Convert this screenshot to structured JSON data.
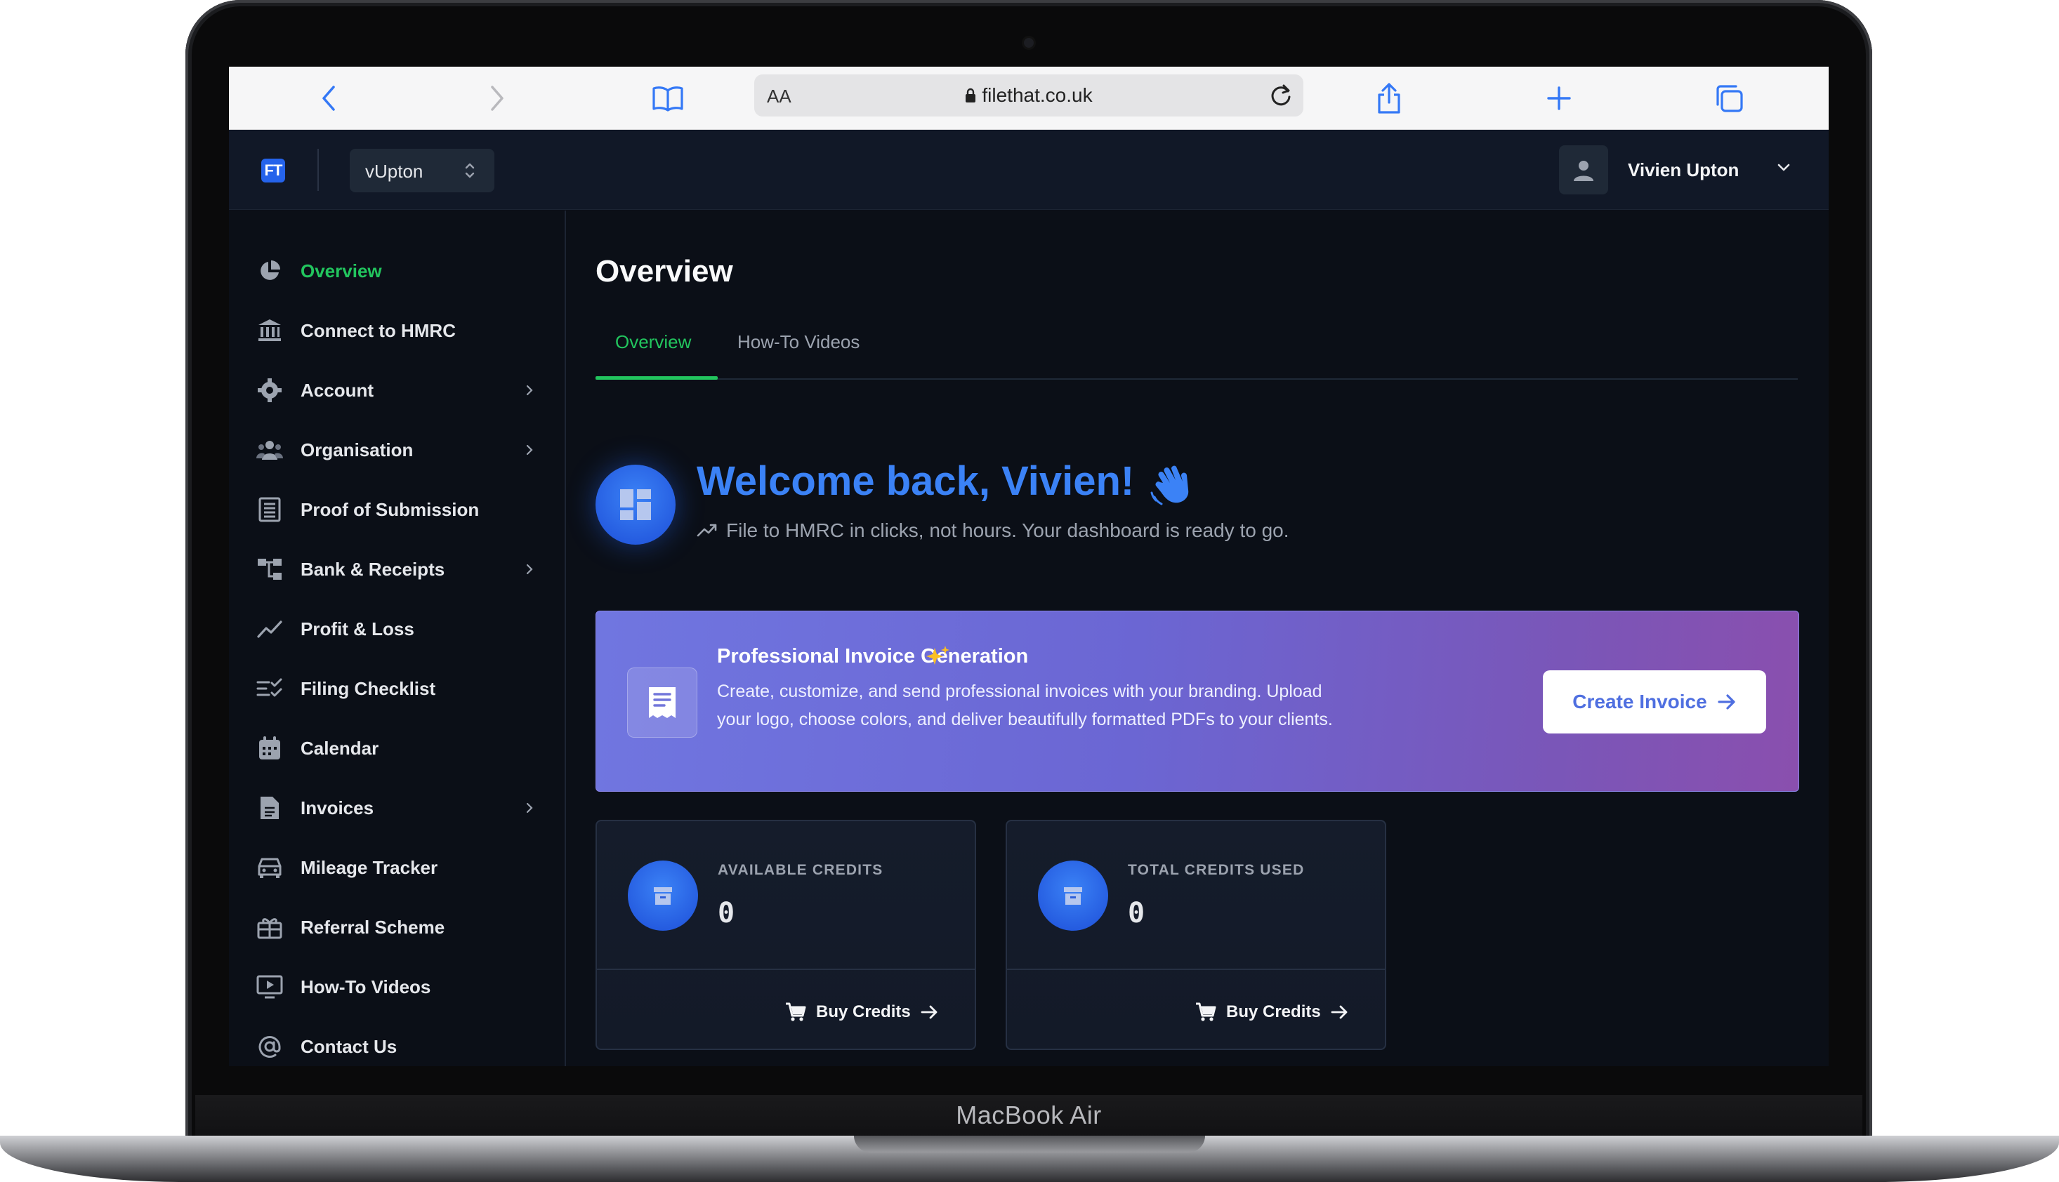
{
  "device": {
    "brand_label": "MacBook Air"
  },
  "browser": {
    "aa_label": "AA",
    "url": "filethat.co.uk"
  },
  "header": {
    "logo_text": "FT",
    "org_selector": "vUpton",
    "user_name": "Vivien Upton"
  },
  "sidebar": {
    "items": [
      {
        "label": "Overview",
        "icon": "pie-chart-icon",
        "active": true,
        "has_submenu": false
      },
      {
        "label": "Connect to HMRC",
        "icon": "bank-icon",
        "active": false,
        "has_submenu": false
      },
      {
        "label": "Account",
        "icon": "gear-icon",
        "active": false,
        "has_submenu": true
      },
      {
        "label": "Organisation",
        "icon": "users-icon",
        "active": false,
        "has_submenu": true
      },
      {
        "label": "Proof of Submission",
        "icon": "document-list-icon",
        "active": false,
        "has_submenu": false
      },
      {
        "label": "Bank & Receipts",
        "icon": "flowchart-icon",
        "active": false,
        "has_submenu": true
      },
      {
        "label": "Profit & Loss",
        "icon": "trend-line-icon",
        "active": false,
        "has_submenu": false
      },
      {
        "label": "Filing Checklist",
        "icon": "checklist-icon",
        "active": false,
        "has_submenu": false
      },
      {
        "label": "Calendar",
        "icon": "calendar-icon",
        "active": false,
        "has_submenu": false
      },
      {
        "label": "Invoices",
        "icon": "file-icon",
        "active": false,
        "has_submenu": true
      },
      {
        "label": "Mileage Tracker",
        "icon": "car-icon",
        "active": false,
        "has_submenu": false
      },
      {
        "label": "Referral Scheme",
        "icon": "gift-icon",
        "active": false,
        "has_submenu": false
      },
      {
        "label": "How-To Videos",
        "icon": "video-icon",
        "active": false,
        "has_submenu": false
      },
      {
        "label": "Contact Us",
        "icon": "at-sign-icon",
        "active": false,
        "has_submenu": false
      }
    ]
  },
  "main": {
    "title": "Overview",
    "tabs": [
      {
        "label": "Overview",
        "active": true
      },
      {
        "label": "How-To Videos",
        "active": false
      }
    ],
    "welcome": {
      "title": "Welcome back, Vivien!",
      "subtitle": "File to HMRC in clicks, not hours. Your dashboard is ready to go."
    },
    "banner": {
      "title": "Professional Invoice Generation",
      "text": "Create, customize, and send professional invoices with your branding. Upload your logo, choose colors, and deliver beautifully formatted PDFs to your clients.",
      "button": "Create Invoice"
    },
    "cards": [
      {
        "label": "AVAILABLE CREDITS",
        "value": "0",
        "action": "Buy Credits"
      },
      {
        "label": "TOTAL CREDITS USED",
        "value": "0",
        "action": "Buy Credits"
      }
    ]
  },
  "colors": {
    "accent_green": "#22c55e",
    "accent_blue": "#3b82f6",
    "background": "#0b0f17",
    "header": "#111827"
  }
}
